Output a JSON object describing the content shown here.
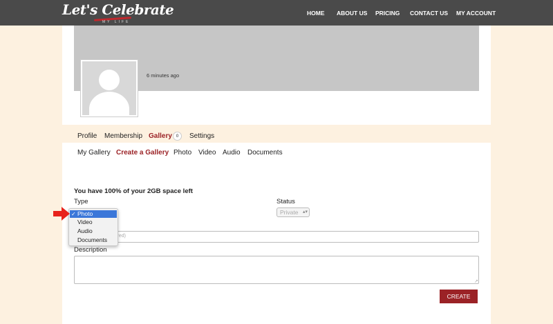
{
  "header": {
    "logo_main": "Let's Celebrate",
    "logo_sub": "MY LIFE",
    "nav": [
      "HOME",
      "ABOUT US",
      "PRICING",
      "CONTACT US",
      "MY ACCOUNT"
    ]
  },
  "profile": {
    "timestamp": "6 minutes ago"
  },
  "tabs": {
    "items": [
      "Profile",
      "Membership",
      "Gallery",
      "Settings"
    ],
    "active": "Gallery",
    "gallery_count": "0"
  },
  "subtabs": {
    "items": [
      "My Gallery",
      "Create a Gallery",
      "Photo",
      "Video",
      "Audio",
      "Documents"
    ],
    "active": "Create a Gallery"
  },
  "form": {
    "space_note": "You have 100% of your 2GB space left",
    "type_label": "Type",
    "type_options": [
      "Photo",
      "Video",
      "Audio",
      "Documents"
    ],
    "type_selected": "Photo",
    "status_label": "Status",
    "status_value": "Private",
    "name_placeholder_visible": "ired)",
    "description_label": "Description",
    "create_label": "CREATE"
  },
  "colors": {
    "accent": "#9b2226",
    "header_bg": "#4a4a4a",
    "page_bg": "#fdf1e0",
    "selection": "#3b77d9",
    "annotation_arrow": "#e8221b"
  }
}
